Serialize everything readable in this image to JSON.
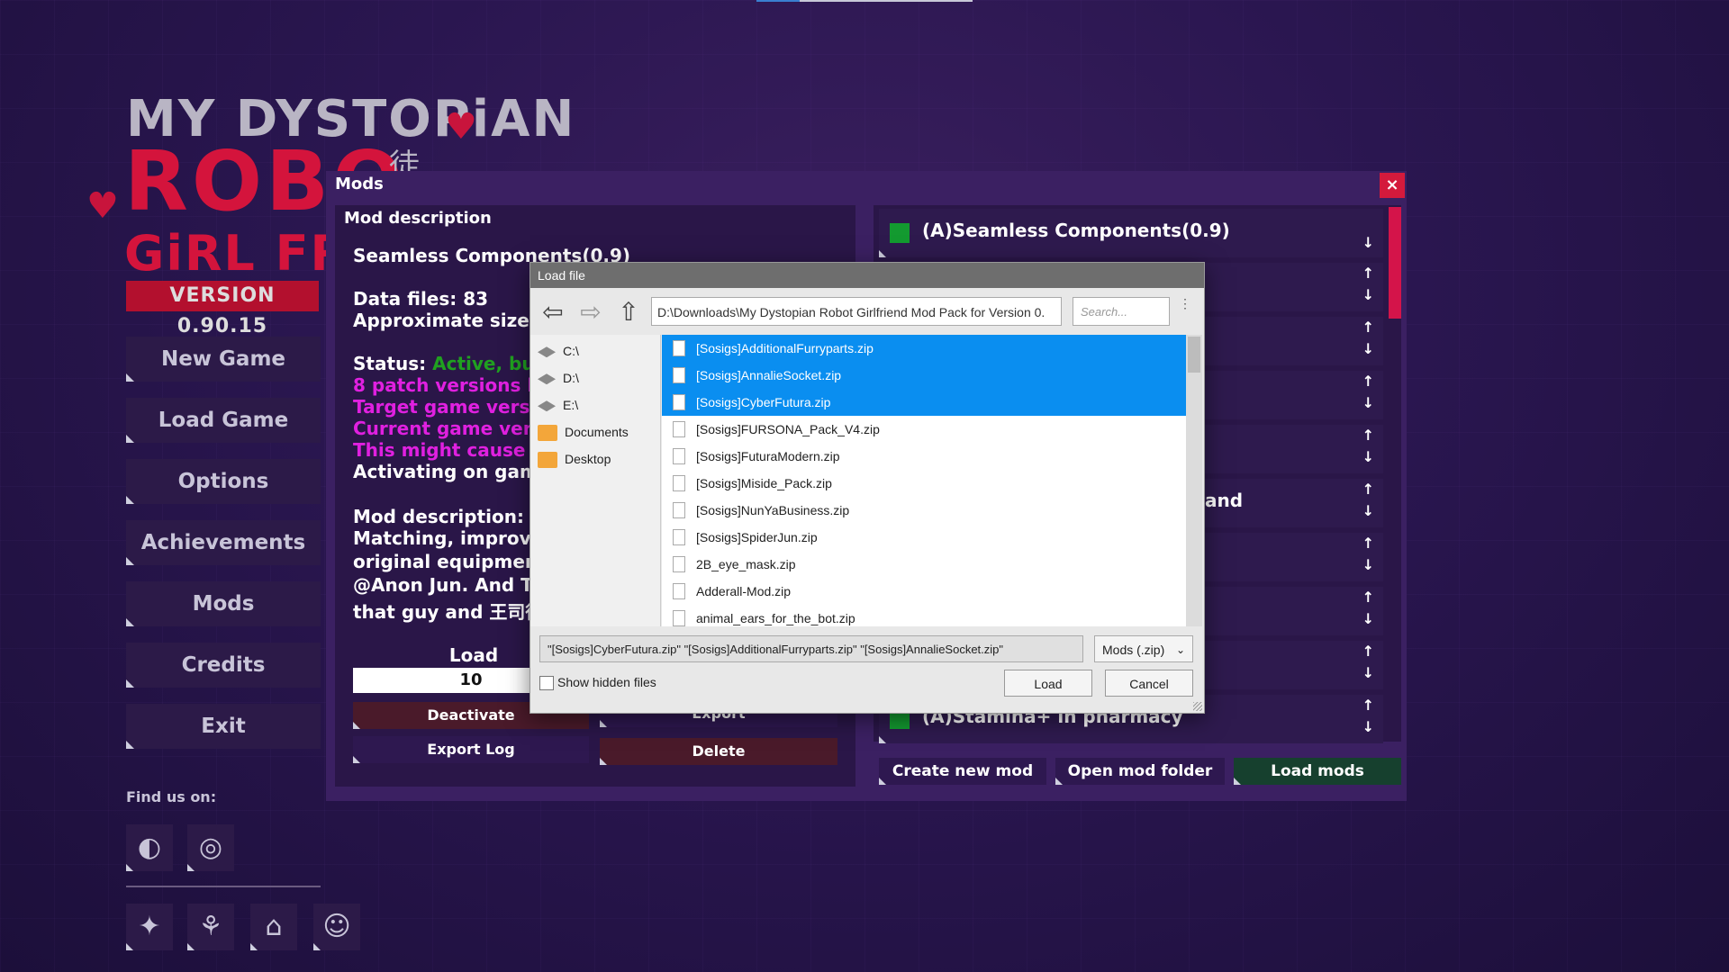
{
  "logo": {
    "line1": "MY DYSTOPiAN",
    "line2": "ROBO",
    "line3": "GiRL FR",
    "kanji": "徒",
    "version": "VERSION 0.90.15"
  },
  "menu": {
    "items": [
      {
        "label": "New Game"
      },
      {
        "label": "Load Game"
      },
      {
        "label": "Options"
      },
      {
        "label": "Achievements"
      },
      {
        "label": "Mods"
      },
      {
        "label": "Credits"
      },
      {
        "label": "Exit"
      }
    ],
    "find_us": "Find us on:"
  },
  "mods_panel": {
    "title": "Mods",
    "close_glyph": "×",
    "desc_header": "Mod description",
    "selected_mod": "Seamless Components(0.9)",
    "data_files": "Data files: 83",
    "approx_size": "Approximate size:",
    "status_label": "Status:",
    "status_value": "Active, but",
    "warn1": "8 patch versions be",
    "warn2": "Target game versio",
    "warn3": "Current game vers",
    "warn4": "This might cause is",
    "activating": "Activating on gam",
    "mod_desc_label": "Mod description:",
    "desc_line1": "Matching, improvin",
    "desc_line2": "original equipment",
    "desc_line3": "@Anon Jun. And Th",
    "desc_line4": "that guy and 王司徒",
    "load_order_label": "Load Order",
    "load_order_value": "10",
    "buttons": {
      "deactivate": "Deactivate",
      "export": "Export",
      "export_log": "Export Log",
      "delete": "Delete"
    }
  },
  "mod_list": {
    "first": "(A)Seamless Components(0.9)",
    "partial": "and",
    "last": "(A)Stamina+ in pharmacy",
    "arrow_up": "↑",
    "arrow_down": "↓",
    "buttons": {
      "create": "Create new mod",
      "open_folder": "Open mod folder",
      "load_mods": "Load mods"
    }
  },
  "dialog": {
    "title": "Load file",
    "back": "⇦",
    "forward": "⇨",
    "up": "⇧",
    "path": "D:\\Downloads\\My Dystopian Robot Girlfriend Mod Pack for Version 0.",
    "search_placeholder": "Search...",
    "dots": "⋮",
    "drives": [
      "C:\\",
      "D:\\",
      "E:\\"
    ],
    "folders": [
      "Documents",
      "Desktop"
    ],
    "files": [
      {
        "name": "[Sosigs]AdditionalFurryparts.zip",
        "selected": true
      },
      {
        "name": "[Sosigs]AnnalieSocket.zip",
        "selected": true
      },
      {
        "name": "[Sosigs]CyberFutura.zip",
        "selected": true
      },
      {
        "name": "[Sosigs]FURSONA_Pack_V4.zip",
        "selected": false
      },
      {
        "name": "[Sosigs]FuturaModern.zip",
        "selected": false
      },
      {
        "name": "[Sosigs]Miside_Pack.zip",
        "selected": false
      },
      {
        "name": "[Sosigs]NunYaBusiness.zip",
        "selected": false
      },
      {
        "name": "[Sosigs]SpiderJun.zip",
        "selected": false
      },
      {
        "name": "2B_eye_mask.zip",
        "selected": false
      },
      {
        "name": "Adderall-Mod.zip",
        "selected": false
      },
      {
        "name": "animal_ears_for_the_bot.zip",
        "selected": false
      }
    ],
    "filename_value": "\"[Sosigs]CyberFutura.zip\" \"[Sosigs]AdditionalFurryparts.zip\" \"[Sosigs]AnnalieSocket.zip\"",
    "filter": "Mods (.zip)",
    "filter_chevron": "⌄",
    "show_hidden": "Show hidden files",
    "load_btn": "Load",
    "cancel_btn": "Cancel"
  },
  "colors": {
    "accent_red": "#d41a3c",
    "selection_blue": "#0a8ef0",
    "active_green": "#139a30",
    "warning_magenta": "#e020e0"
  }
}
